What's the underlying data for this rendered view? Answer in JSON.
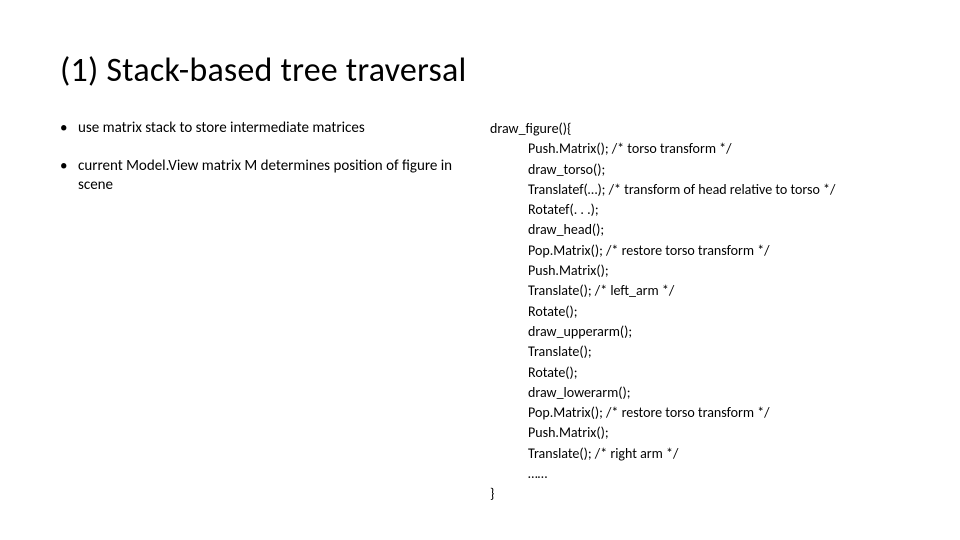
{
  "title": "(1) Stack-based tree traversal",
  "bullets": [
    "use matrix stack to store intermediate matrices",
    "current Model.View matrix M determines position of figure in scene"
  ],
  "code": {
    "header": "draw_figure(){",
    "lines": [
      "Push.Matrix(); /* torso transform */",
      "draw_torso();",
      "Translatef(…); /* transform of head relative to torso */",
      "Rotatef(. . .);",
      "draw_head();",
      "Pop.Matrix(); /* restore torso transform */",
      "Push.Matrix();",
      "Translate(); /* left_arm */",
      "Rotate();",
      "draw_upperarm();",
      "Translate();",
      "Rotate();",
      "draw_lowerarm();",
      "Pop.Matrix(); /* restore torso transform */",
      "Push.Matrix();",
      "Translate(); /* right arm */",
      "……"
    ],
    "footer": "}"
  }
}
